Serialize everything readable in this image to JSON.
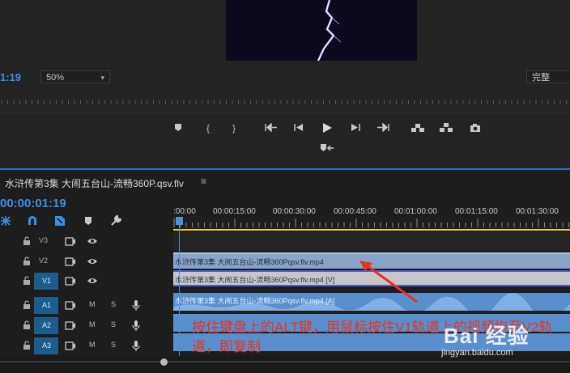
{
  "monitor": {
    "timecode": "1:19",
    "zoom": "50%",
    "quality": "完整",
    "transport_icons": [
      "add-marker-icon",
      "mark-in-icon",
      "mark-out-icon",
      "go-to-in-icon",
      "step-back-icon",
      "play-icon",
      "step-forward-icon",
      "go-to-out-icon",
      "lift-icon",
      "extract-icon",
      "export-frame-icon",
      "button-editor-icon"
    ]
  },
  "timeline": {
    "tab_title": "水浒传第3集 大闹五台山-流畅360P.qsv.flv",
    "tab_menu": "≡",
    "timecode": "00:00:01:19",
    "ruler_labels": [
      ":00:00",
      "00:00:15:00",
      "00:00:30:00",
      "00:00:45:00",
      "00:01:00:00",
      "00:01:15:00",
      "00:01:30:00"
    ],
    "tracks": {
      "v3": "V3",
      "v2": "V2",
      "v1": "V1",
      "a1": "A1",
      "a2": "A2",
      "a3": "A3",
      "mute": "M",
      "solo": "S"
    },
    "clips": {
      "v2": "水浒传第3集 大闹五台山-流畅360Pqsv.flv.mp4",
      "v1": "水浒传第3集 大闹五台山-流畅360Pqsv.flv.mp4 [V]",
      "a1": "水浒传第3集 大闹五台山-流畅360Pqsv.flv.mp4 [A]"
    }
  },
  "annotation": "按住键盘上的ALT键，用鼠标按住V1轨道上的视频拖至V2轨道，即复制",
  "watermark": {
    "main": "Bai 经验",
    "url": "jingyan.baidu.com"
  },
  "colors": {
    "accent": "#3d8fe0",
    "annotation": "#e8321e",
    "workarea": "#f0d400"
  }
}
